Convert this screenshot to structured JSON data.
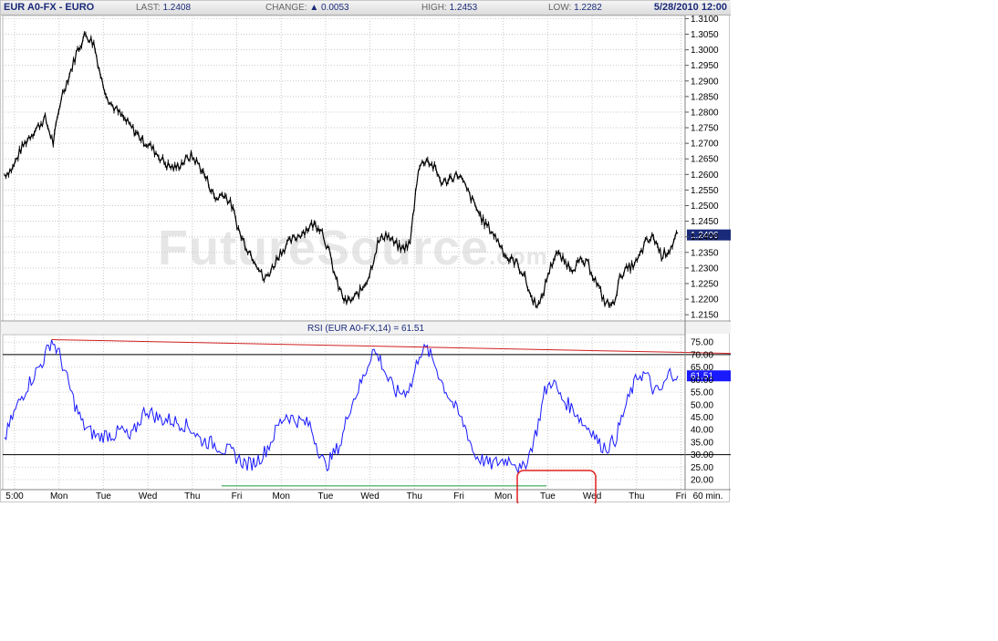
{
  "header": {
    "symbol": "EUR A0-FX - EURO",
    "last_label": "LAST:",
    "last_value": "1.2408",
    "change_label": "CHANGE:",
    "change_value": "0.0053",
    "high_label": "HIGH:",
    "high_value": "1.2453",
    "low_label": "LOW:",
    "low_value": "1.2282",
    "datetime": "5/28/2010 12:00"
  },
  "watermark": {
    "main": "FutureSource",
    "suffix": ".com"
  },
  "chart_data": [
    {
      "type": "line",
      "series": [
        {
          "values": [
            1.26,
            1.262,
            1.268,
            1.272,
            1.275,
            1.278,
            1.27,
            1.285,
            1.292,
            1.3,
            1.305,
            1.302,
            1.29,
            1.283,
            1.28,
            1.277,
            1.274,
            1.271,
            1.269,
            1.266,
            1.263,
            1.262,
            1.264,
            1.266,
            1.263,
            1.258,
            1.252,
            1.254,
            1.25,
            1.241,
            1.236,
            1.232,
            1.226,
            1.23,
            1.235,
            1.238,
            1.24,
            1.242,
            1.244,
            1.243,
            1.235,
            1.225,
            1.219,
            1.22,
            1.223,
            1.228,
            1.238,
            1.241,
            1.238,
            1.236,
            1.238,
            1.262,
            1.265,
            1.262,
            1.257,
            1.259,
            1.26,
            1.255,
            1.25,
            1.245,
            1.242,
            1.238,
            1.233,
            1.232,
            1.228,
            1.22,
            1.218,
            1.228,
            1.235,
            1.232,
            1.23,
            1.232,
            1.231,
            1.225,
            1.219,
            1.218,
            1.228,
            1.23,
            1.232,
            1.238,
            1.24,
            1.234,
            1.236,
            1.241
          ]
        }
      ],
      "ylim": [
        1.213,
        1.311
      ],
      "y_ticks": [
        "1.3100",
        "1.3050",
        "1.3000",
        "1.2950",
        "1.2900",
        "1.2850",
        "1.2800",
        "1.2750",
        "1.2700",
        "1.2650",
        "1.2600",
        "1.2550",
        "1.2500",
        "1.2450",
        "1.2400",
        "1.2350",
        "1.2300",
        "1.2250",
        "1.2200",
        "1.2150"
      ],
      "y_tick_values": [
        1.31,
        1.305,
        1.3,
        1.295,
        1.29,
        1.285,
        1.28,
        1.275,
        1.27,
        1.265,
        1.26,
        1.255,
        1.25,
        1.245,
        1.24,
        1.235,
        1.23,
        1.225,
        1.22,
        1.215
      ],
      "last_price_label": "1.2406",
      "last_price_value": 1.2406,
      "line_color": "#000000"
    },
    {
      "type": "line",
      "title": "RSI (EUR A0-FX,14) = 61.51",
      "series": [
        {
          "values": [
            36,
            45,
            52,
            58,
            63,
            68,
            76,
            70,
            60,
            50,
            42,
            39,
            37,
            38,
            38,
            40,
            36,
            42,
            48,
            46,
            44,
            44,
            43,
            42,
            40,
            36,
            35,
            34,
            32,
            31,
            28,
            26,
            27,
            30,
            35,
            42,
            46,
            44,
            43,
            42,
            33,
            25,
            30,
            35,
            48,
            55,
            62,
            72,
            68,
            60,
            55,
            55,
            58,
            71,
            72,
            66,
            58,
            52,
            46,
            40,
            30,
            28,
            26,
            27,
            28,
            28,
            23,
            30,
            40,
            55,
            60,
            53,
            50,
            47,
            42,
            40,
            34,
            33,
            36,
            46,
            55,
            62,
            62,
            55,
            56,
            63,
            61.51
          ]
        }
      ],
      "ylim": [
        16,
        78
      ],
      "y_ticks": [
        "75.00",
        "70.00",
        "65.00",
        "60.00",
        "55.00",
        "50.00",
        "45.00",
        "40.00",
        "35.00",
        "30.00",
        "25.00",
        "20.00"
      ],
      "y_tick_values": [
        75,
        70,
        65,
        60,
        55,
        50,
        45,
        40,
        35,
        30,
        25,
        20
      ],
      "last_value_label": "61.51",
      "last_value": 61.51,
      "levels": [
        70,
        30
      ],
      "line_color": "#1a1aff",
      "resistance_color": "#d02020",
      "support_color": "#1a9a3a"
    }
  ],
  "x_axis": {
    "labels": [
      "5:00",
      "Mon",
      "Tue",
      "Wed",
      "Thu",
      "Fri",
      "Mon",
      "Tue",
      "Wed",
      "Thu",
      "Fri",
      "Mon",
      "Tue",
      "Wed",
      "Thu",
      "Fri"
    ],
    "interval": "60 min."
  },
  "annotation": {
    "color": "#e02020"
  }
}
